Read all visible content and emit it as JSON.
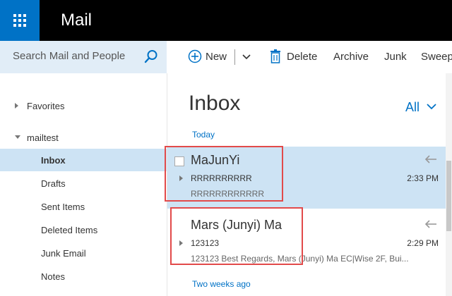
{
  "app": {
    "title": "Mail"
  },
  "search": {
    "placeholder": "Search Mail and People"
  },
  "toolbar": {
    "new_label": "New",
    "delete_label": "Delete",
    "archive_label": "Archive",
    "junk_label": "Junk",
    "sweep_label": "Sweep"
  },
  "nav": {
    "favorites": "Favorites",
    "account": "mailtest",
    "folders": [
      "Inbox",
      "Drafts",
      "Sent Items",
      "Deleted Items",
      "Junk Email",
      "Notes"
    ]
  },
  "list": {
    "title": "Inbox",
    "filter": "All",
    "groups": {
      "today": "Today",
      "older": "Two weeks ago"
    },
    "messages": [
      {
        "sender": "MaJunYi",
        "subject": "RRRRRRRRRR",
        "preview": "RRRRRRRRRRRR",
        "time": "2:33 PM"
      },
      {
        "sender": "Mars (Junyi) Ma",
        "subject": "123123",
        "preview": "123123 Best Regards, Mars (Junyi) Ma EC|Wise 2F, Bui...",
        "time": "2:29 PM"
      }
    ]
  },
  "colors": {
    "accent": "#0072c6",
    "selected": "#cde3f4",
    "header": "#000000",
    "highlight": "#e24a4a"
  }
}
